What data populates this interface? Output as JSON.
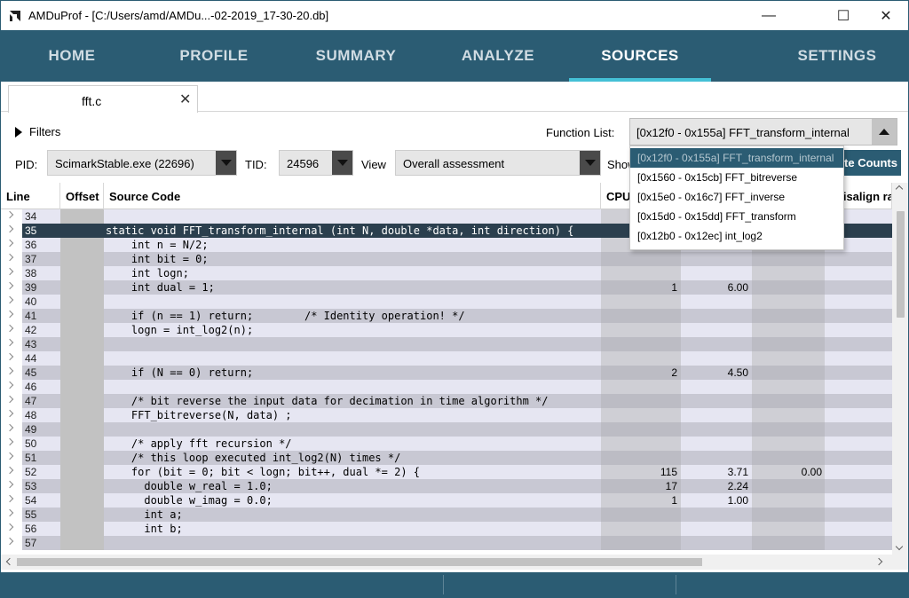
{
  "window": {
    "title": "AMDuProf - [C:/Users/amd/AMDu...-02-2019_17-30-20.db]",
    "controls": {
      "minimize": "—",
      "maximize": "☐",
      "close": "✕"
    }
  },
  "nav": {
    "items": [
      {
        "label": "HOME"
      },
      {
        "label": "PROFILE"
      },
      {
        "label": "SUMMARY"
      },
      {
        "label": "ANALYZE"
      },
      {
        "label": "SOURCES"
      },
      {
        "label": "SETTINGS"
      }
    ],
    "active": "SOURCES",
    "accent": "#2b5c73",
    "underline_color": "#44c0d6"
  },
  "tab": {
    "label": "fft.c",
    "close": "✕"
  },
  "filters": {
    "toggle_label": "Filters",
    "function_list_label": "Function List:",
    "function_selected": "[0x12f0 - 0x155a] FFT_transform_internal",
    "pid_label": "PID:",
    "pid_value": "ScimarkStable.exe (22696)",
    "tid_label": "TID:",
    "tid_value": "24596",
    "view_label": "View",
    "view_value": "Overall assessment",
    "show_label": "Show",
    "compute_button": "Compute Counts"
  },
  "dropdown": {
    "options": [
      "[0x12f0 - 0x155a] FFT_transform_internal",
      "[0x1560 - 0x15cb] FFT_bitreverse",
      "[0x15e0 - 0x16c7] FFT_inverse",
      "[0x15d0 - 0x15dd] FFT_transform",
      "[0x12b0 - 0x12ec] int_log2"
    ],
    "selected_index": 0
  },
  "table": {
    "headers": [
      "Line",
      "Offset",
      "Source Code",
      "CPU",
      "",
      "",
      "Misalign rat"
    ],
    "rows": [
      {
        "line": "34",
        "src": "",
        "cpu": "",
        "ipc": "",
        "c3": ""
      },
      {
        "line": "35",
        "src": "static void FFT_transform_internal (int N, double *data, int direction) {",
        "cpu": "",
        "ipc": "",
        "c3": "",
        "selected": true
      },
      {
        "line": "36",
        "src": "    int n = N/2;",
        "cpu": "",
        "ipc": "",
        "c3": ""
      },
      {
        "line": "37",
        "src": "    int bit = 0;",
        "cpu": "",
        "ipc": "",
        "c3": ""
      },
      {
        "line": "38",
        "src": "    int logn;",
        "cpu": "",
        "ipc": "",
        "c3": ""
      },
      {
        "line": "39",
        "src": "    int dual = 1;",
        "cpu": "1",
        "ipc": "6.00",
        "c3": ""
      },
      {
        "line": "40",
        "src": "",
        "cpu": "",
        "ipc": "",
        "c3": ""
      },
      {
        "line": "41",
        "src": "    if (n == 1) return;        /* Identity operation! */",
        "cpu": "",
        "ipc": "",
        "c3": ""
      },
      {
        "line": "42",
        "src": "    logn = int_log2(n);",
        "cpu": "",
        "ipc": "",
        "c3": ""
      },
      {
        "line": "43",
        "src": "",
        "cpu": "",
        "ipc": "",
        "c3": ""
      },
      {
        "line": "44",
        "src": "",
        "cpu": "",
        "ipc": "",
        "c3": ""
      },
      {
        "line": "45",
        "src": "    if (N == 0) return;",
        "cpu": "2",
        "ipc": "4.50",
        "c3": ""
      },
      {
        "line": "46",
        "src": "",
        "cpu": "",
        "ipc": "",
        "c3": ""
      },
      {
        "line": "47",
        "src": "    /* bit reverse the input data for decimation in time algorithm */",
        "cpu": "",
        "ipc": "",
        "c3": ""
      },
      {
        "line": "48",
        "src": "    FFT_bitreverse(N, data) ;",
        "cpu": "",
        "ipc": "",
        "c3": ""
      },
      {
        "line": "49",
        "src": "",
        "cpu": "",
        "ipc": "",
        "c3": ""
      },
      {
        "line": "50",
        "src": "    /* apply fft recursion */",
        "cpu": "",
        "ipc": "",
        "c3": ""
      },
      {
        "line": "51",
        "src": "    /* this loop executed int_log2(N) times */",
        "cpu": "",
        "ipc": "",
        "c3": ""
      },
      {
        "line": "52",
        "src": "    for (bit = 0; bit < logn; bit++, dual *= 2) {",
        "cpu": "115",
        "ipc": "3.71",
        "c3": "0.00"
      },
      {
        "line": "53",
        "src": "      double w_real = 1.0;",
        "cpu": "17",
        "ipc": "2.24",
        "c3": ""
      },
      {
        "line": "54",
        "src": "      double w_imag = 0.0;",
        "cpu": "1",
        "ipc": "1.00",
        "c3": ""
      },
      {
        "line": "55",
        "src": "      int a;",
        "cpu": "",
        "ipc": "",
        "c3": ""
      },
      {
        "line": "56",
        "src": "      int b;",
        "cpu": "",
        "ipc": "",
        "c3": ""
      },
      {
        "line": "57",
        "src": "",
        "cpu": "",
        "ipc": "",
        "c3": ""
      }
    ]
  },
  "icons": {
    "app": "amd-logo-icon",
    "filters": "triangle-right-icon",
    "row_expand": "chevron-right-icon"
  }
}
